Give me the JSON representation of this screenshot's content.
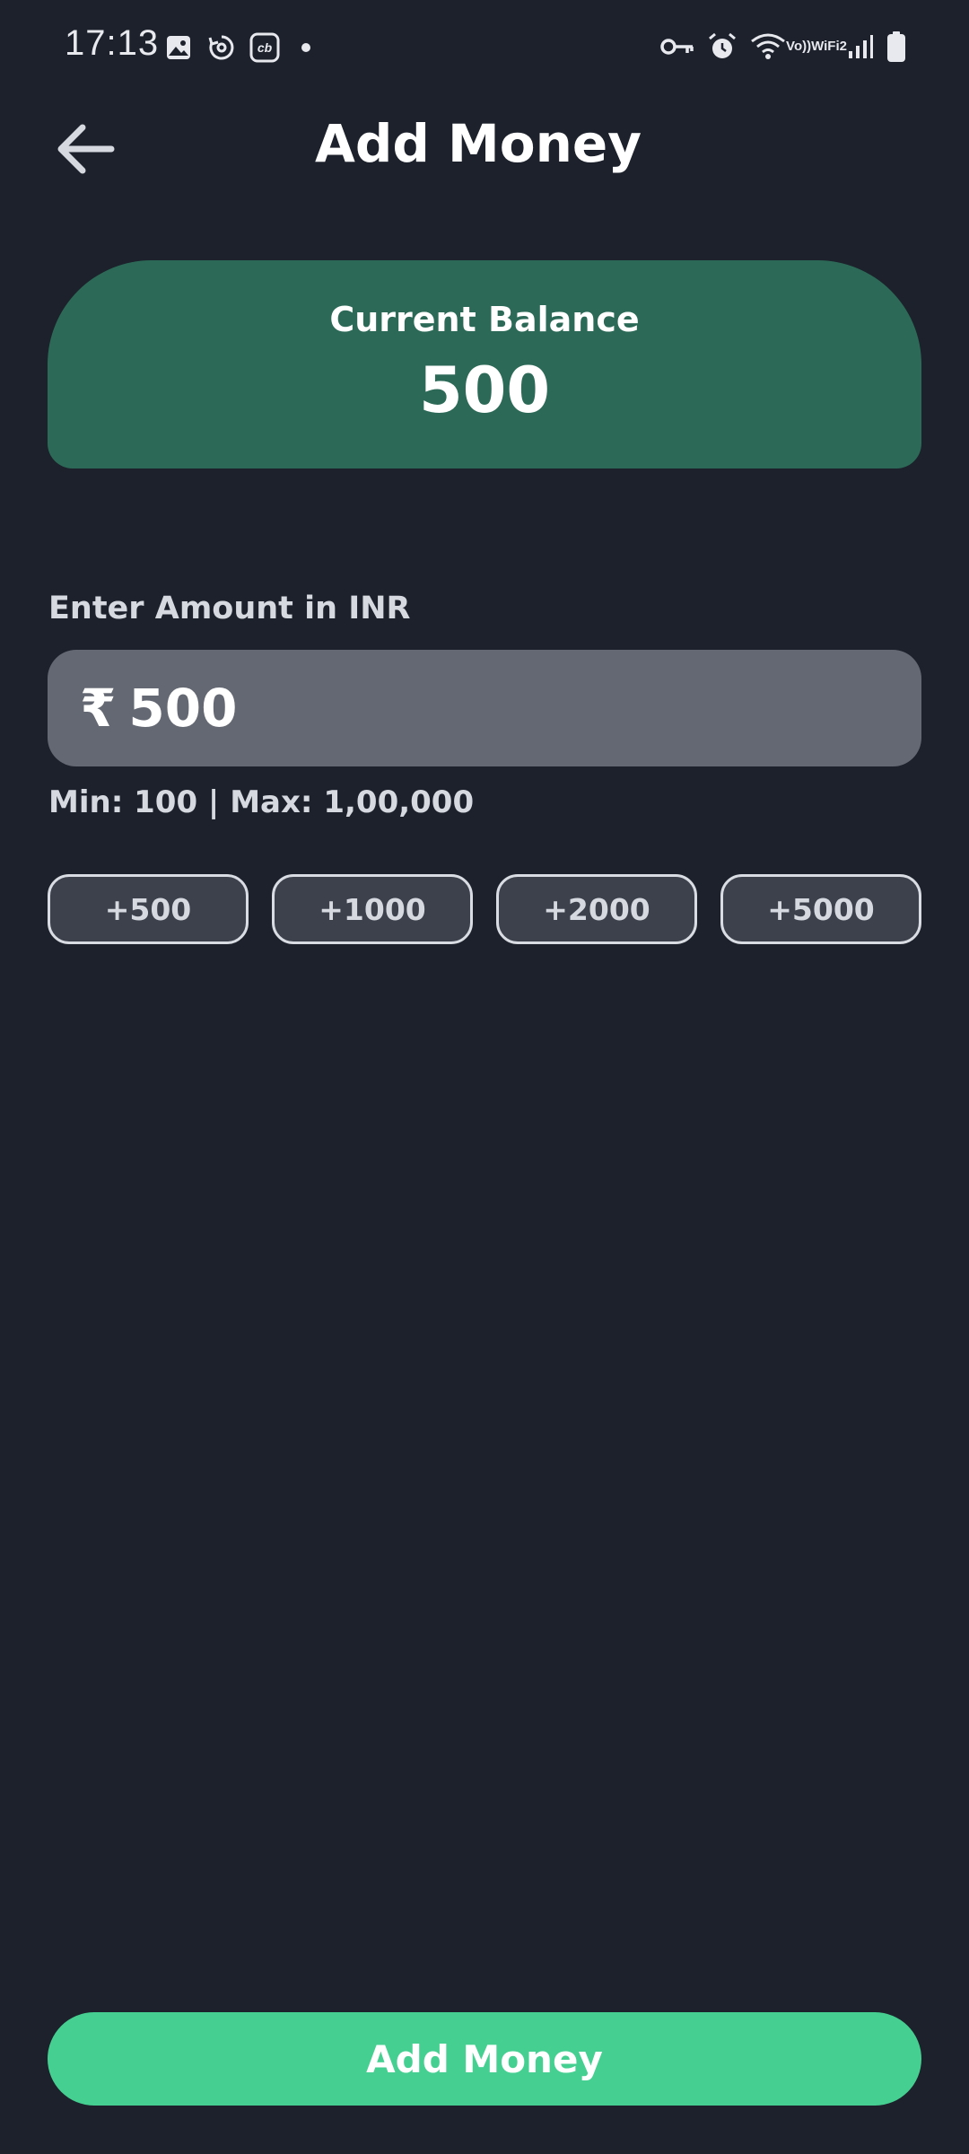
{
  "status_bar": {
    "time": "17:13",
    "left_icons": [
      "image-icon",
      "sync-icon",
      "cb-app-icon",
      "notification-dot-icon"
    ],
    "right_icons": [
      "vpn-key-icon",
      "alarm-icon",
      "wifi-icon",
      "vowifi-icon",
      "signal-icon",
      "battery-icon"
    ],
    "vowifi_top": "Vo))",
    "vowifi_bottom": "WiFi2",
    "cb_label": "cb"
  },
  "header": {
    "title": "Add Money",
    "back_icon": "arrow-left-icon"
  },
  "balance_card": {
    "label": "Current Balance",
    "value": "500",
    "color": "#2c6a57"
  },
  "amount": {
    "label": "Enter Amount in INR",
    "currency_symbol": "₹",
    "value": "500",
    "limits": "Min: 100 | Max: 1,00,000"
  },
  "quick_add": [
    {
      "label": "+500"
    },
    {
      "label": "+1000"
    },
    {
      "label": "+2000"
    },
    {
      "label": "+5000"
    }
  ],
  "footer": {
    "button_label": "Add Money",
    "button_color": "#45d091"
  },
  "colors": {
    "background": "#1c212b",
    "input_background": "#646872",
    "chip_background": "#3c414c"
  }
}
